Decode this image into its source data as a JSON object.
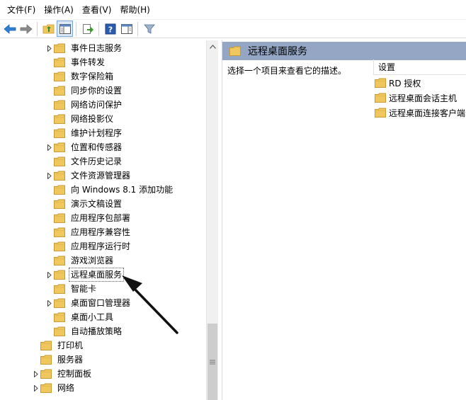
{
  "menubar": {
    "file": "文件(F)",
    "action": "操作(A)",
    "view": "查看(V)",
    "help": "帮助(H)"
  },
  "toolbar": {
    "icons": [
      "back-icon",
      "forward-icon",
      "up-folder-icon",
      "show-hide-tree-icon",
      "export-icon",
      "help-icon",
      "properties-icon",
      "filter-icon"
    ]
  },
  "tree": {
    "items": [
      {
        "label": "事件日志服务",
        "expandable": true
      },
      {
        "label": "事件转发",
        "expandable": false
      },
      {
        "label": "数字保险箱",
        "expandable": false
      },
      {
        "label": "同步你的设置",
        "expandable": false
      },
      {
        "label": "网络访问保护",
        "expandable": false
      },
      {
        "label": "网络投影仪",
        "expandable": false
      },
      {
        "label": "维护计划程序",
        "expandable": false
      },
      {
        "label": "位置和传感器",
        "expandable": true
      },
      {
        "label": "文件历史记录",
        "expandable": false
      },
      {
        "label": "文件资源管理器",
        "expandable": true
      },
      {
        "label": "向 Windows 8.1 添加功能",
        "expandable": false
      },
      {
        "label": "演示文稿设置",
        "expandable": false
      },
      {
        "label": "应用程序包部署",
        "expandable": false
      },
      {
        "label": "应用程序兼容性",
        "expandable": false
      },
      {
        "label": "应用程序运行时",
        "expandable": false
      },
      {
        "label": "游戏浏览器",
        "expandable": false
      },
      {
        "label": "远程桌面服务",
        "expandable": true,
        "selected": true
      },
      {
        "label": "智能卡",
        "expandable": false
      },
      {
        "label": "桌面窗口管理器",
        "expandable": true
      },
      {
        "label": "桌面小工具",
        "expandable": false
      },
      {
        "label": "自动播放策略",
        "expandable": false
      }
    ],
    "parent_items": [
      {
        "label": "打印机",
        "expandable": false
      },
      {
        "label": "服务器",
        "expandable": false
      },
      {
        "label": "控制面板",
        "expandable": true
      },
      {
        "label": "网络",
        "expandable": true
      }
    ]
  },
  "right": {
    "title": "远程桌面服务",
    "description": "选择一个项目来查看它的描述。",
    "settings_header": "设置",
    "settings": [
      "RD 授权",
      "远程桌面会话主机",
      "远程桌面连接客户端"
    ]
  },
  "colors": {
    "header_bg": "#94a6c4",
    "folder": "#f0c75e",
    "arrow": "#111111"
  }
}
